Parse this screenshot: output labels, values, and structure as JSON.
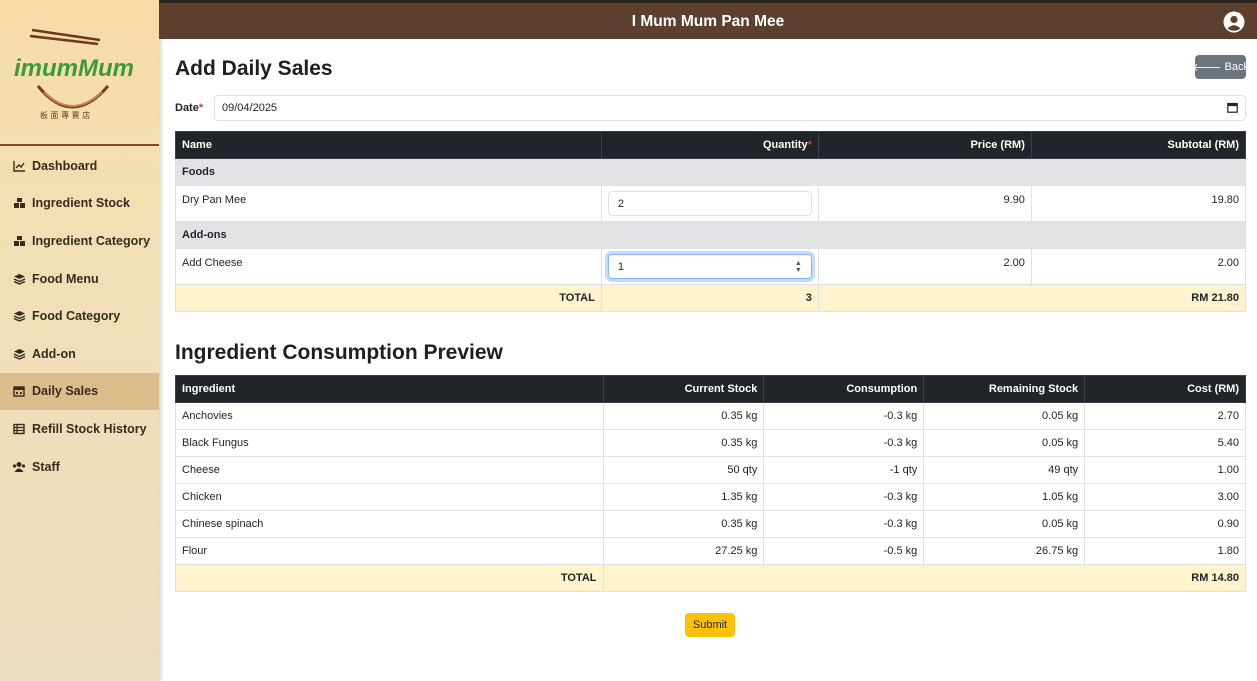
{
  "app": {
    "title": "I Mum Mum Pan Mee"
  },
  "brand": {
    "logo_text": "imumMum",
    "logo_sub": "板面專賣店"
  },
  "sidebar": {
    "items": [
      {
        "label": "Dashboard",
        "icon": "chart-line-icon"
      },
      {
        "label": "Ingredient Stock",
        "icon": "boxes-icon"
      },
      {
        "label": "Ingredient Category",
        "icon": "boxes-icon"
      },
      {
        "label": "Food Menu",
        "icon": "layers-icon"
      },
      {
        "label": "Food Category",
        "icon": "layers-icon"
      },
      {
        "label": "Add-on",
        "icon": "layers-icon"
      },
      {
        "label": "Daily Sales",
        "icon": "calendar-icon",
        "active": true
      },
      {
        "label": "Refill Stock History",
        "icon": "table-icon"
      },
      {
        "label": "Staff",
        "icon": "users-icon"
      }
    ]
  },
  "page": {
    "title": "Add Daily Sales",
    "back_label": "Back",
    "date_label": "Date",
    "date_required_mark": "*",
    "date_value": "09/04/2025",
    "submit_label": "Submit"
  },
  "sales_table": {
    "headers": {
      "name": "Name",
      "quantity": "Quantity",
      "quantity_required": "*",
      "price": "Price (RM)",
      "subtotal": "Subtotal (RM)"
    },
    "groups": [
      {
        "name": "Foods",
        "rows": [
          {
            "name": "Dry Pan Mee",
            "quantity": "2",
            "price": "9.90",
            "subtotal": "19.80"
          }
        ]
      },
      {
        "name": "Add-ons",
        "rows": [
          {
            "name": "Add Cheese",
            "quantity": "1",
            "price": "2.00",
            "subtotal": "2.00"
          }
        ]
      }
    ],
    "total_label": "TOTAL",
    "total_quantity": "3",
    "total_amount": "RM 21.80"
  },
  "consumption": {
    "title": "Ingredient Consumption Preview",
    "headers": {
      "ingredient": "Ingredient",
      "current": "Current Stock",
      "consumption": "Consumption",
      "remaining": "Remaining Stock",
      "cost": "Cost (RM)"
    },
    "rows": [
      {
        "ingredient": "Anchovies",
        "current": "0.35 kg",
        "consumption": "-0.3 kg",
        "remaining": "0.05 kg",
        "cost": "2.70"
      },
      {
        "ingredient": "Black Fungus",
        "current": "0.35 kg",
        "consumption": "-0.3 kg",
        "remaining": "0.05 kg",
        "cost": "5.40"
      },
      {
        "ingredient": "Cheese",
        "current": "50 qty",
        "consumption": "-1 qty",
        "remaining": "49 qty",
        "cost": "1.00"
      },
      {
        "ingredient": "Chicken",
        "current": "1.35 kg",
        "consumption": "-0.3 kg",
        "remaining": "1.05 kg",
        "cost": "3.00"
      },
      {
        "ingredient": "Chinese spinach",
        "current": "0.35 kg",
        "consumption": "-0.3 kg",
        "remaining": "0.05 kg",
        "cost": "0.90"
      },
      {
        "ingredient": "Flour",
        "current": "27.25 kg",
        "consumption": "-0.5 kg",
        "remaining": "26.75 kg",
        "cost": "1.80"
      }
    ],
    "total_label": "TOTAL",
    "total_cost": "RM 14.80"
  },
  "colors": {
    "topbar": "#5c3f2c",
    "accent_submit": "#ffc107",
    "total_row": "#fff3cd",
    "header_dark": "#212529"
  }
}
